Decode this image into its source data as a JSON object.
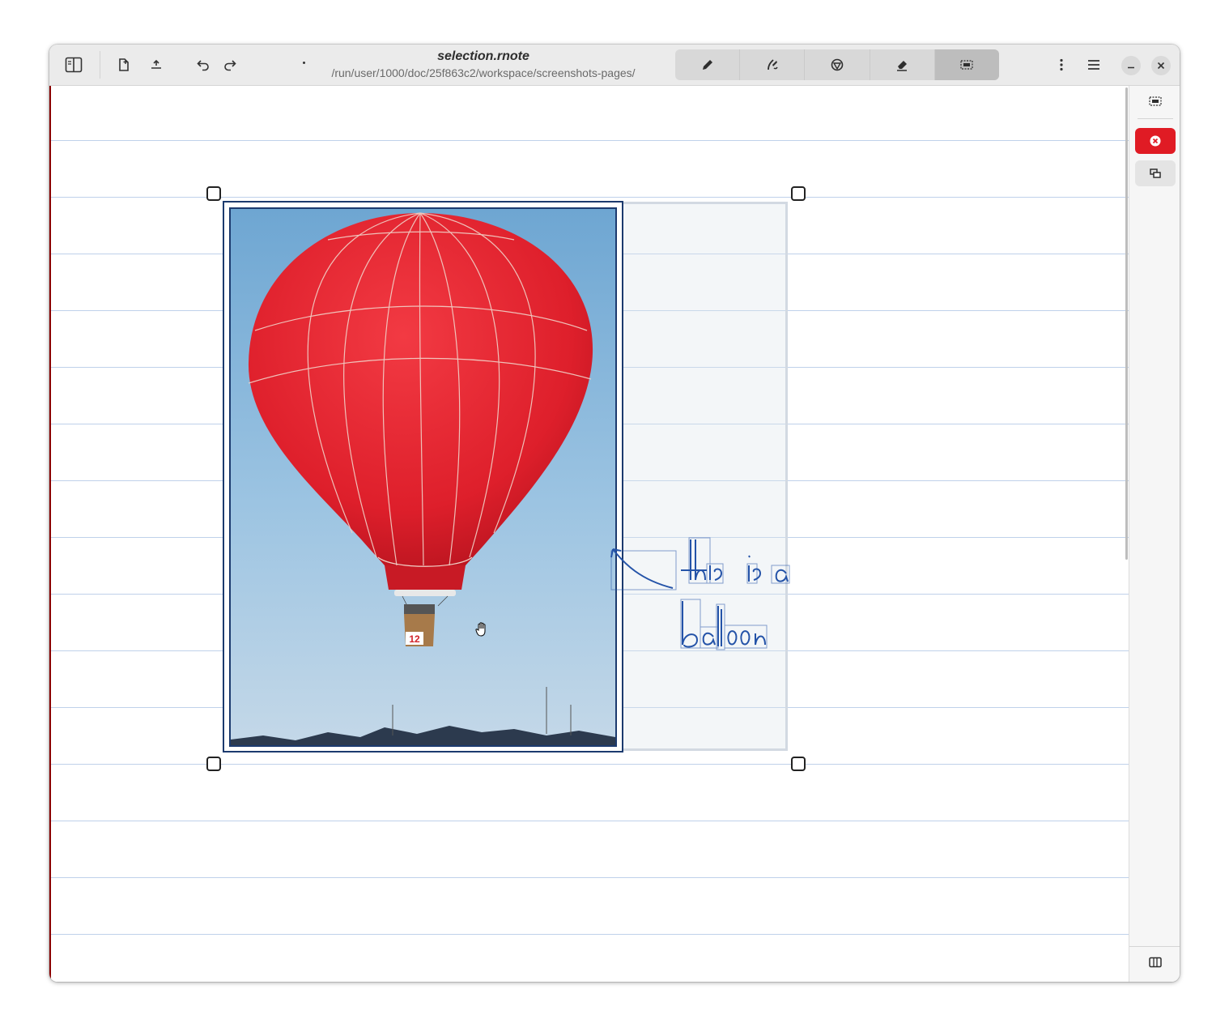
{
  "app": {
    "filename": "selection.rnote",
    "path": "/run/user/1000/doc/25f863c2/workspace/screenshots-pages/"
  },
  "header": {
    "left_buttons": [
      "sidebar-toggle-icon",
      "new-document-icon",
      "import-icon",
      "undo-icon",
      "redo-icon"
    ],
    "tools": [
      {
        "name": "pen-icon",
        "active": false
      },
      {
        "name": "shaper-icon",
        "active": false
      },
      {
        "name": "typewriter-icon",
        "active": false
      },
      {
        "name": "eraser-icon",
        "active": false
      },
      {
        "name": "selector-icon",
        "active": true
      }
    ],
    "right_buttons": [
      "more-options-icon",
      "menu-icon",
      "minimize-icon",
      "close-icon"
    ]
  },
  "canvas": {
    "background": "#ffffff",
    "rule_color": "#bfd1ea",
    "margin_color": "#8b0000",
    "handwriting_color": "#2453a8",
    "selection_handles": [
      "top-left",
      "top-right",
      "bottom-left",
      "bottom-right"
    ]
  },
  "image": {
    "subject": "red hot air balloon",
    "basket_number": "12",
    "sky_color": "#8fb8dc",
    "balloon_color": "#e2232f"
  },
  "sidebar": {
    "items": [
      "selection-mode-icon",
      "delete-selection-icon",
      "duplicate-selection-icon",
      "toggle-panel-icon"
    ],
    "danger_color": "#e01b24"
  }
}
